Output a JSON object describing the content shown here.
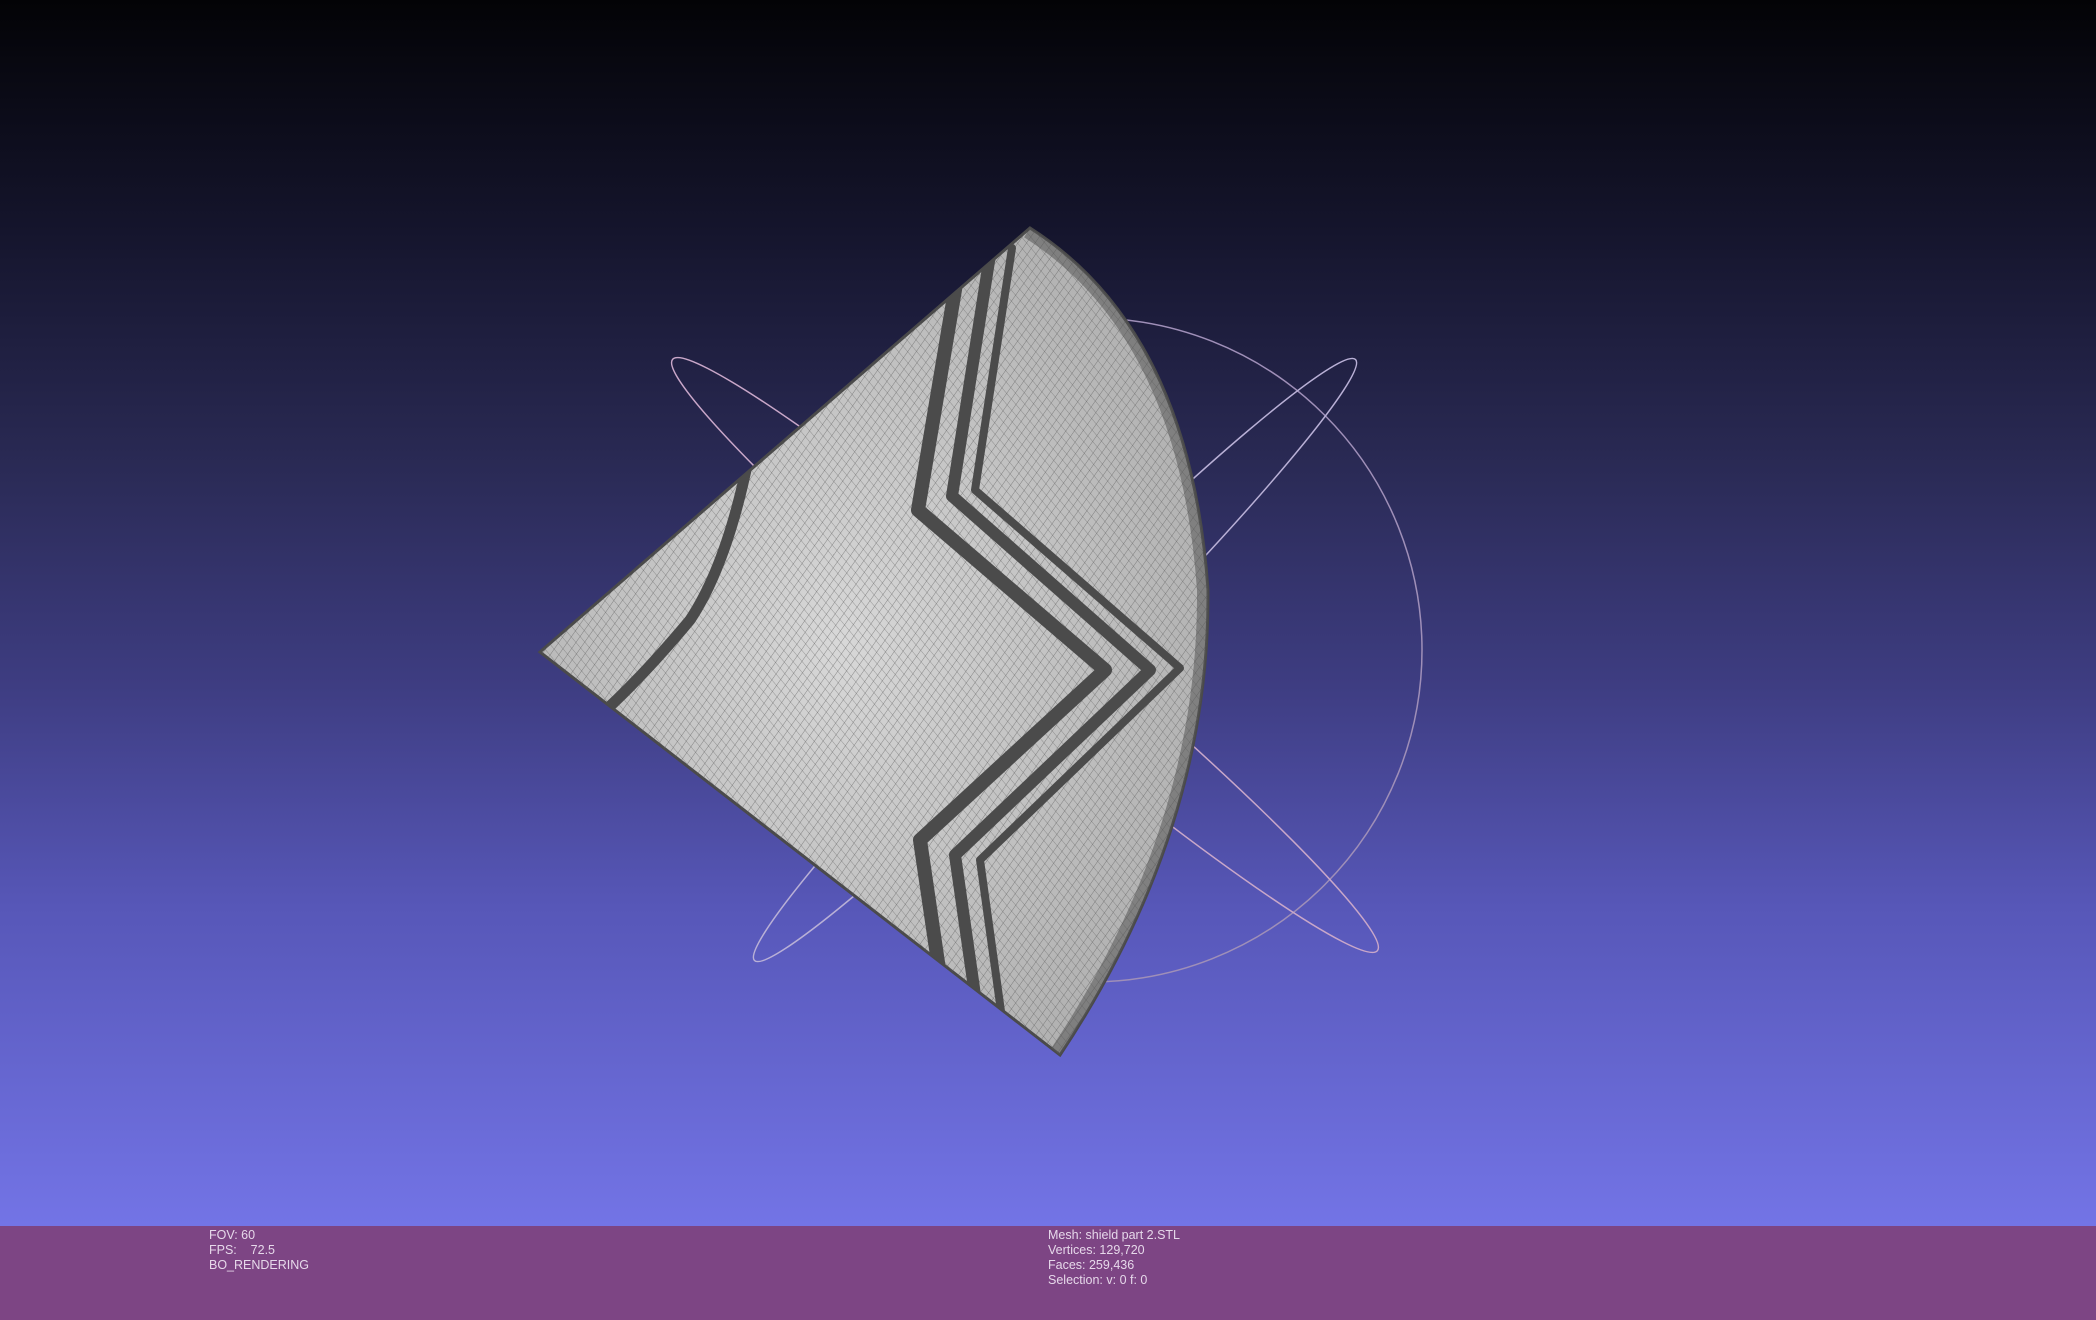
{
  "viewport": {
    "object": "mesh-wireframe",
    "trackball": true,
    "colors": {
      "background_top": "#030306",
      "background_bottom": "#7374e6",
      "mesh_fill": "#cfcfcf",
      "mesh_edges": "#4d4d4d",
      "info_bar": "#7d4584"
    }
  },
  "status_left": {
    "fov": "FOV: 60",
    "fps": "FPS:    72.5",
    "render_mode": "BO_RENDERING"
  },
  "status_right": {
    "mesh": "Mesh: shield part 2.STL",
    "vertices": "Vertices: 129,720",
    "faces": "Faces: 259,436",
    "selection": "Selection: v: 0 f: 0"
  }
}
